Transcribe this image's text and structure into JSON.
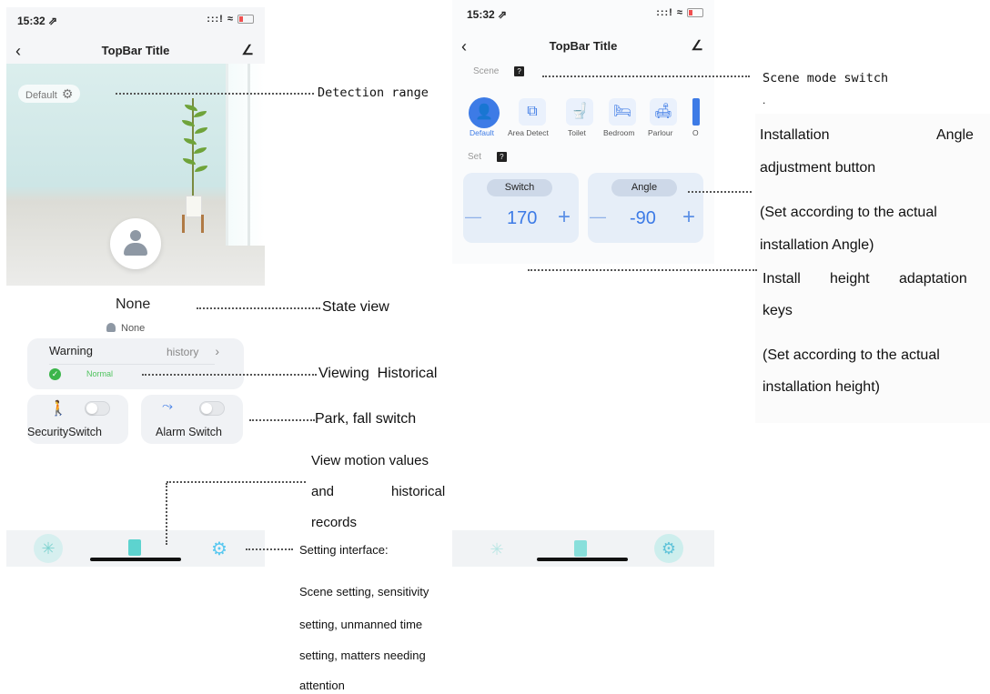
{
  "left_phone": {
    "status_time": "15:32 ⇗",
    "status_icons": ":::! ≈",
    "back_icon": "‹",
    "title": "TopBar Title",
    "edit_icon": "∠",
    "default_chip": "Default",
    "state_text": "None",
    "state_sub": "None",
    "warning_label": "Warning",
    "history_label": "history",
    "history_chevron": "›",
    "normal_label": "Normal",
    "security_label": "SecuritySwitch",
    "alarm_label": "Alarm Switch",
    "accent_green": "#3bb54a",
    "accent_blue": "#3d7be6"
  },
  "right_phone": {
    "status_time": "15:32 ⇗",
    "status_icons": ":::! ≈",
    "back_icon": "‹",
    "title": "TopBar Title",
    "edit_icon": "∠",
    "scene_label": "Scene",
    "scene_help": "?",
    "set_label": "Set",
    "set_help": "?",
    "scenes": [
      {
        "label": "Default",
        "icon": "person-icon"
      },
      {
        "label": "Area Detect",
        "icon": "cast-icon"
      },
      {
        "label": "Toilet",
        "icon": "toilet-icon"
      },
      {
        "label": "Bedroom",
        "icon": "bed-icon"
      },
      {
        "label": "Parlour",
        "icon": "sofa-icon"
      },
      {
        "label": "O",
        "icon": "other-icon"
      }
    ],
    "switch_pill": "Switch",
    "switch_value": "170",
    "angle_pill": "Angle",
    "angle_value": "-90",
    "minus": "—",
    "plus": "+"
  },
  "annotations": {
    "detection_range": "Detection range",
    "state_view": "State view",
    "viewing_historical": "Viewing  Historical",
    "park_fall": "Park, fall switch",
    "motion_1": "View motion values",
    "motion_2a": "and",
    "motion_2b": "historical",
    "motion_3": "records",
    "setting_interface": "Setting interface:",
    "setting_1": "Scene setting, sensitivity",
    "setting_2": "setting, unmanned time",
    "setting_3": "setting, matters needing",
    "setting_4": "attention",
    "scene_mode_switch": "Scene mode switch",
    "dot": ".",
    "install_1a": "Installation",
    "install_1b": "Angle",
    "install_2": "adjustment button",
    "install_3": "(Set according to the actual",
    "install_4": "installation Angle)",
    "height_1a": "Install",
    "height_1b": "height",
    "height_1c": "adaptation",
    "height_2": "keys",
    "height_3": "(Set according to the actual",
    "height_4": "installation height)"
  }
}
